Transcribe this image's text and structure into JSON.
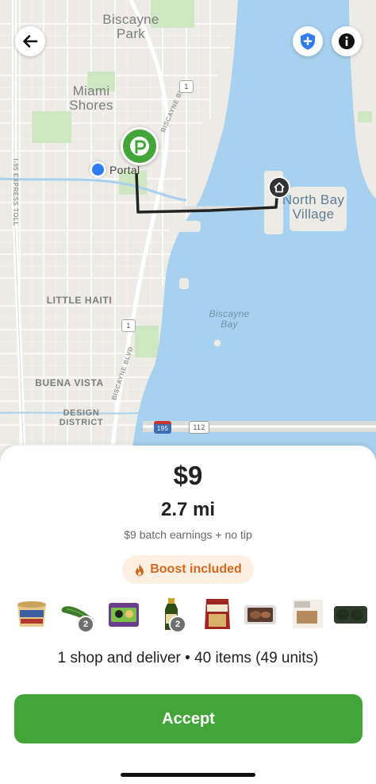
{
  "map": {
    "labels": {
      "biscayne_park": "Biscayne\nPark",
      "miami_shores": "Miami\nShores",
      "portal": "Portal",
      "north_bay_village": "North Bay\nVillage",
      "little_haiti": "LITTLE HAITI",
      "biscayne_bay": "Biscayne\nBay",
      "buena_vista": "BUENA VISTA",
      "design_district": "DESIGN\nDISTRICT",
      "i95_express": "I-95 EXPRESS TOLL",
      "biscayne_blvd_upper": "BISCAYNE BLVD",
      "biscayne_blvd_lower": "BISCAYNE BLVD",
      "route_1_upper": "1",
      "route_1_lower": "1",
      "interstate_195": "195",
      "route_112": "112"
    },
    "icons": {
      "back": "arrow-left-icon",
      "shield": "shield-plus-icon",
      "info": "info-icon",
      "store": "publix-p-logo",
      "home": "home-icon"
    },
    "colors": {
      "water": "#a8d1ef",
      "land": "#ecebe6",
      "park": "#cfe6c3",
      "route": "#222222",
      "store_pin": "#43a43a",
      "current_location": "#2f7bf0"
    }
  },
  "offer": {
    "pay": "$9",
    "distance": "2.7 mi",
    "earnings_note": "$9 batch earnings + no tip",
    "boost_label": "Boost included",
    "boost_icon": "flame-icon",
    "items": [
      {
        "name": "ice-cream-tub",
        "badge": ""
      },
      {
        "name": "cucumber",
        "badge": "2"
      },
      {
        "name": "snack-box",
        "badge": ""
      },
      {
        "name": "olive-oil-bottle",
        "badge": "2"
      },
      {
        "name": "cheese-bag",
        "badge": ""
      },
      {
        "name": "meat-package",
        "badge": ""
      },
      {
        "name": "sandwich-package",
        "badge": ""
      },
      {
        "name": "avocado-pack",
        "badge": ""
      }
    ],
    "summary": "1 shop and deliver • 40 items (49 units)",
    "accept_label": "Accept"
  },
  "colors": {
    "accent": "#43a43a",
    "boost_text": "#d2691e",
    "boost_bg": "#fdf0e3"
  }
}
